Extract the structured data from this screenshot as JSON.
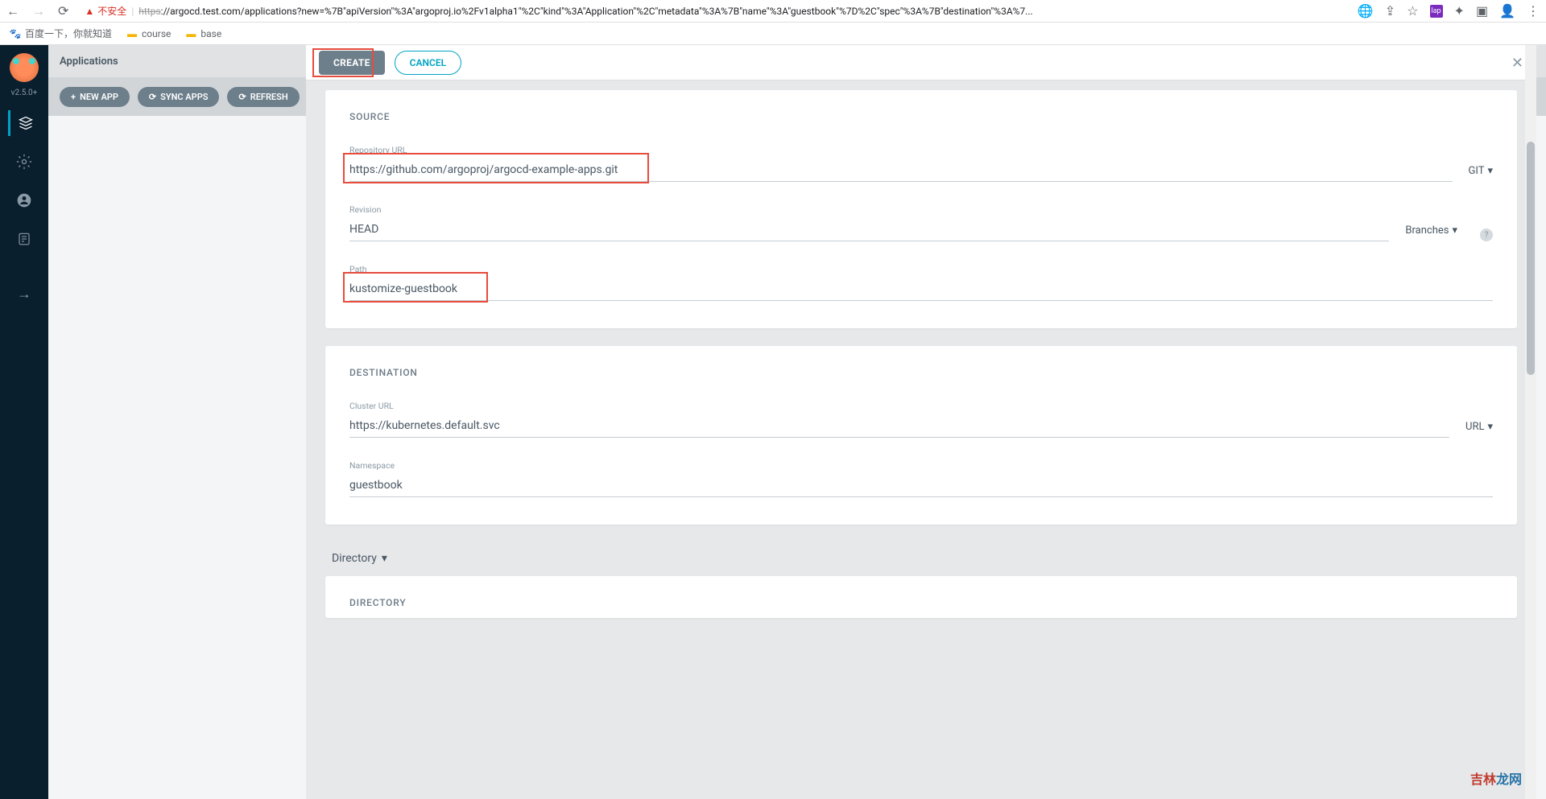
{
  "browser": {
    "insecure_label": "不安全",
    "url_protocol": "https",
    "url_rest": "://argocd.test.com/applications?new=%7B\"apiVersion\"%3A\"argoproj.io%2Fv1alpha1\"%2C\"kind\"%3A\"Application\"%2C\"metadata\"%3A%7B\"name\"%3A\"guestbook\"%7D%2C\"spec\"%3A%7B\"destination\"%3A%7...",
    "bookmarks": [
      {
        "label": "百度一下，你就知道",
        "icon": "🐾"
      },
      {
        "label": "course",
        "icon": "📁"
      },
      {
        "label": "base",
        "icon": "📁"
      }
    ]
  },
  "sidebar": {
    "version": "v2.5.0+"
  },
  "page": {
    "title": "Applications",
    "buttons": {
      "new": "NEW APP",
      "sync": "SYNC APPS",
      "refresh": "REFRESH"
    }
  },
  "panel": {
    "create": "CREATE",
    "cancel": "CANCEL",
    "source": {
      "title": "SOURCE",
      "repo_label": "Repository URL",
      "repo_value": "https://github.com/argoproj/argocd-example-apps.git",
      "repo_type": "GIT",
      "revision_label": "Revision",
      "revision_value": "HEAD",
      "revision_type": "Branches",
      "path_label": "Path",
      "path_value": "kustomize-guestbook"
    },
    "destination": {
      "title": "DESTINATION",
      "cluster_label": "Cluster URL",
      "cluster_value": "https://kubernetes.default.svc",
      "cluster_type": "URL",
      "namespace_label": "Namespace",
      "namespace_value": "guestbook"
    },
    "directory_toggle": "Directory",
    "directory_title": "DIRECTORY"
  },
  "watermark": {
    "a": "吉林",
    "b": "龙网"
  }
}
